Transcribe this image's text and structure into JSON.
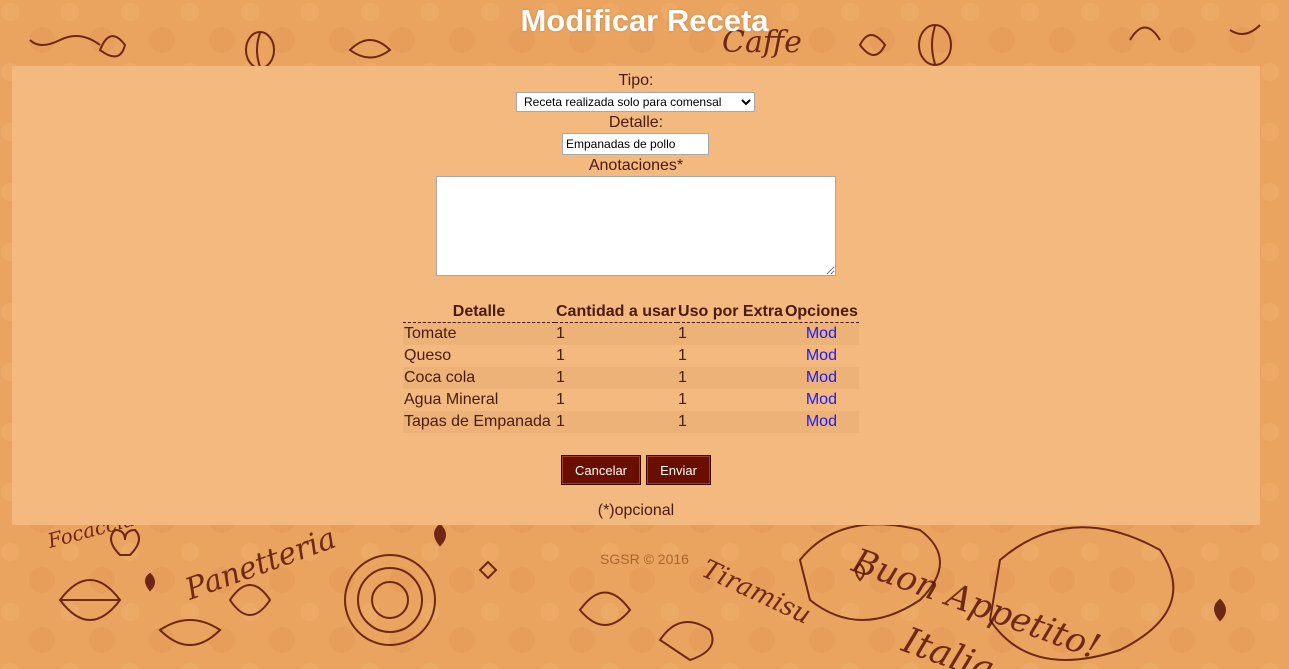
{
  "title": "Modificar Receta",
  "form": {
    "tipo_label": "Tipo:",
    "tipo_value": "Receta realizada solo para comensal",
    "detalle_label": "Detalle:",
    "detalle_value": "Empanadas de pollo",
    "anotaciones_label": "Anotaciones*",
    "anotaciones_value": ""
  },
  "table": {
    "headers": [
      "Detalle",
      "Cantidad a usar",
      "Uso por Extra",
      "Opciones"
    ],
    "rows": [
      {
        "detalle": "Tomate",
        "cantidad": "1",
        "extra": "1",
        "opcion": "Mod"
      },
      {
        "detalle": "Queso",
        "cantidad": "1",
        "extra": "1",
        "opcion": "Mod"
      },
      {
        "detalle": "Coca cola",
        "cantidad": "1",
        "extra": "1",
        "opcion": "Mod"
      },
      {
        "detalle": "Agua Mineral",
        "cantidad": "1",
        "extra": "1",
        "opcion": "Mod"
      },
      {
        "detalle": "Tapas de Empanada",
        "cantidad": "1",
        "extra": "1",
        "opcion": "Mod"
      }
    ]
  },
  "buttons": {
    "cancel": "Cancelar",
    "submit": "Enviar"
  },
  "note": "(*)opcional",
  "footer": "SGSR © 2016",
  "colors": {
    "panel": "#f3b97f",
    "button": "#6a0e00",
    "text": "#4a1a10",
    "link": "#1a1aff"
  },
  "background_text": [
    "Caffe",
    "Focaccia",
    "Panetteria",
    "Tiramisu",
    "Buon Appetito!",
    "Italia"
  ]
}
